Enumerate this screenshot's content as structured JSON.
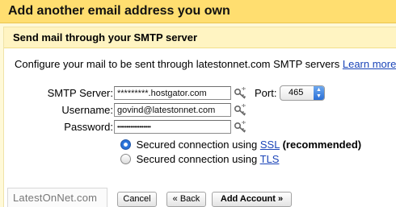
{
  "dialog": {
    "title": "Add another email address you own"
  },
  "section": {
    "heading": "Send mail through your SMTP server",
    "intro_text": "Configure your mail to be sent through latestonnet.com SMTP servers",
    "learn_more": "Learn more"
  },
  "form": {
    "smtp_server_label": "SMTP Server:",
    "smtp_server_value": "*********.hostgator.com",
    "port_label": "Port:",
    "port_value": "465",
    "username_label": "Username:",
    "username_value": "govind@latestonnet.com",
    "password_label": "Password:",
    "password_value": "••••••••••••••••••"
  },
  "security": {
    "ssl_prefix": "Secured connection using",
    "ssl_link": "SSL",
    "ssl_note": "(recommended)",
    "ssl_checked": true,
    "tls_prefix": "Secured connection using",
    "tls_link": "TLS",
    "tls_checked": false
  },
  "buttons": {
    "cancel": "Cancel",
    "back": "« Back",
    "add_account": "Add Account »"
  },
  "watermark": "LatestOnNet.com",
  "colors": {
    "title_bar": "#ffde70",
    "subhead": "#fff4c2",
    "link": "#1a44b8",
    "radio_selected": "#2f7be0"
  }
}
